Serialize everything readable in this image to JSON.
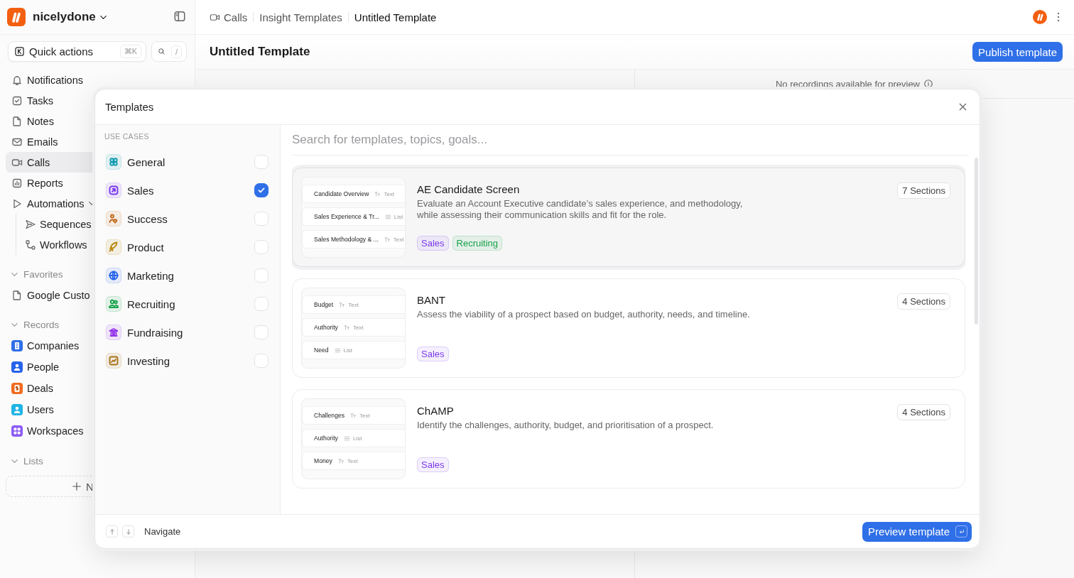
{
  "workspace": {
    "name": "nicelydone"
  },
  "quick_actions": {
    "label": "Quick actions",
    "shortcut": "⌘K",
    "search_shortcut": "/"
  },
  "nav": [
    {
      "label": "Notifications",
      "selected": false
    },
    {
      "label": "Tasks",
      "selected": false
    },
    {
      "label": "Notes",
      "selected": false
    },
    {
      "label": "Emails",
      "selected": false
    },
    {
      "label": "Calls",
      "selected": true
    },
    {
      "label": "Reports",
      "selected": false
    },
    {
      "label": "Automations",
      "selected": false,
      "expanded": true,
      "children": [
        {
          "label": "Sequences",
          "selected": false
        },
        {
          "label": "Workflows",
          "selected": false
        }
      ]
    }
  ],
  "favorites": {
    "label": "Favorites",
    "expanded": true,
    "items": [
      {
        "label": "Google Custo",
        "selected": false
      }
    ]
  },
  "records": {
    "label": "Records",
    "expanded": true,
    "items": [
      {
        "label": "Companies",
        "color": "#2f6fe8",
        "selected": false
      },
      {
        "label": "People",
        "color": "#2563eb",
        "selected": false
      },
      {
        "label": "Deals",
        "color": "#f26b1d",
        "selected": false
      },
      {
        "label": "Users",
        "color": "#1eb4e6",
        "selected": false
      },
      {
        "label": "Workspaces",
        "color": "#8b5cf6",
        "selected": false
      }
    ]
  },
  "lists": {
    "label": "Lists",
    "expanded": true,
    "new_button": "N"
  },
  "breadcrumb": [
    "Calls",
    "Insight Templates",
    "Untitled Template"
  ],
  "page_title": "Untitled Template",
  "publish_button": "Publish template",
  "preview_note": "No recordings available for preview",
  "modal": {
    "title": "Templates",
    "section_label": "USE CASES",
    "use_cases": [
      {
        "label": "General",
        "color": "#0f9bb0",
        "checked": false
      },
      {
        "label": "Sales",
        "color": "#7c3aed",
        "checked": true
      },
      {
        "label": "Success",
        "color": "#c2691b",
        "checked": false
      },
      {
        "label": "Product",
        "color": "#b7860b",
        "checked": false
      },
      {
        "label": "Marketing",
        "color": "#2563eb",
        "checked": false
      },
      {
        "label": "Recruiting",
        "color": "#16a34a",
        "checked": false
      },
      {
        "label": "Fundraising",
        "color": "#9333ea",
        "checked": false
      },
      {
        "label": "Investing",
        "color": "#a8741a",
        "checked": false
      }
    ],
    "search": {
      "placeholder": "Search for templates, topics, goals..."
    },
    "templates": [
      {
        "title": "AE Candidate Screen",
        "description": "Evaluate an Account Executive candidate’s sales experience, and methodology, while assessing their communication skills and fit for the role.",
        "sections_badge": "7 Sections",
        "selected": true,
        "preview": [
          {
            "name": "Candidate Overview",
            "kind": "text",
            "type": "Text"
          },
          {
            "name": "Sales Experience & Tr...",
            "kind": "list",
            "type": "List"
          },
          {
            "name": "Sales Methodology & ...",
            "kind": "text",
            "type": "Text"
          }
        ],
        "tags": [
          {
            "label": "Sales",
            "color": "#7c3aed"
          },
          {
            "label": "Recruiting",
            "color": "#16a34a"
          }
        ]
      },
      {
        "title": "BANT",
        "description": "Assess the viability of a prospect based on budget, authority, needs, and timeline.",
        "sections_badge": "4 Sections",
        "selected": false,
        "preview": [
          {
            "name": "Budget",
            "kind": "text",
            "type": "Text"
          },
          {
            "name": "Authority",
            "kind": "text",
            "type": "Text"
          },
          {
            "name": "Need",
            "kind": "list",
            "type": "List"
          }
        ],
        "tags": [
          {
            "label": "Sales",
            "color": "#7c3aed"
          }
        ]
      },
      {
        "title": "ChAMP",
        "description": "Identify the challenges, authority, budget, and prioritisation of a prospect.",
        "sections_badge": "4 Sections",
        "selected": false,
        "preview": [
          {
            "name": "Challenges",
            "kind": "text",
            "type": "Text"
          },
          {
            "name": "Authority",
            "kind": "list",
            "type": "List"
          },
          {
            "name": "Money",
            "kind": "text",
            "type": "Text"
          }
        ],
        "tags": [
          {
            "label": "Sales",
            "color": "#7c3aed"
          }
        ]
      }
    ],
    "footer": {
      "hint": "Navigate",
      "button": "Preview template"
    }
  }
}
